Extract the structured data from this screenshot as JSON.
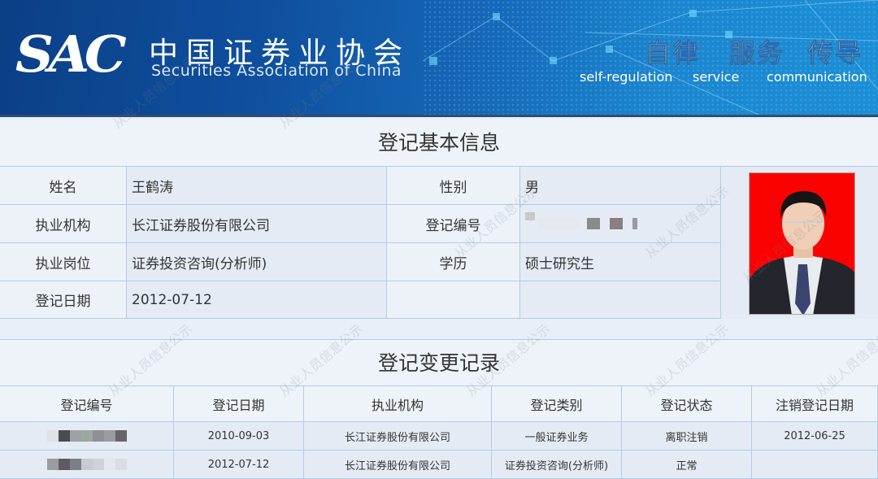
{
  "header": {
    "logo_text": "SAC",
    "org_name_cn": "中国证券业协会",
    "org_name_en": "Securities Association of China",
    "slogans": [
      {
        "cn": "自律",
        "en": "self-regulation"
      },
      {
        "cn": "服务",
        "en": "service"
      },
      {
        "cn": "传导",
        "en": "communication"
      }
    ]
  },
  "basic_info": {
    "title": "登记基本信息",
    "fields": {
      "name": {
        "label": "姓名",
        "value": "王鹤涛"
      },
      "gender": {
        "label": "性别",
        "value": "男"
      },
      "institution": {
        "label": "执业机构",
        "value": "长江证券股份有限公司"
      },
      "reg_no": {
        "label": "登记编号",
        "value": "[redacted]"
      },
      "position": {
        "label": "执业岗位",
        "value": "证券投资咨询(分析师)"
      },
      "education": {
        "label": "学历",
        "value": "硕士研究生"
      },
      "reg_date": {
        "label": "登记日期",
        "value": "2012-07-12"
      }
    },
    "photo_alt": "证件照"
  },
  "change_records": {
    "title": "登记变更记录",
    "columns": [
      "登记编号",
      "登记日期",
      "执业机构",
      "登记类别",
      "登记状态",
      "注销登记日期"
    ],
    "rows": [
      [
        "[redacted]",
        "2010-09-03",
        "长江证券股份有限公司",
        "一般证券业务",
        "离职注销",
        "2012-06-25"
      ],
      [
        "[redacted]",
        "2012-07-12",
        "长江证券股份有限公司",
        "证券投资咨询(分析师)",
        "正常",
        ""
      ]
    ]
  },
  "watermark_text": "从业人员信息公示"
}
